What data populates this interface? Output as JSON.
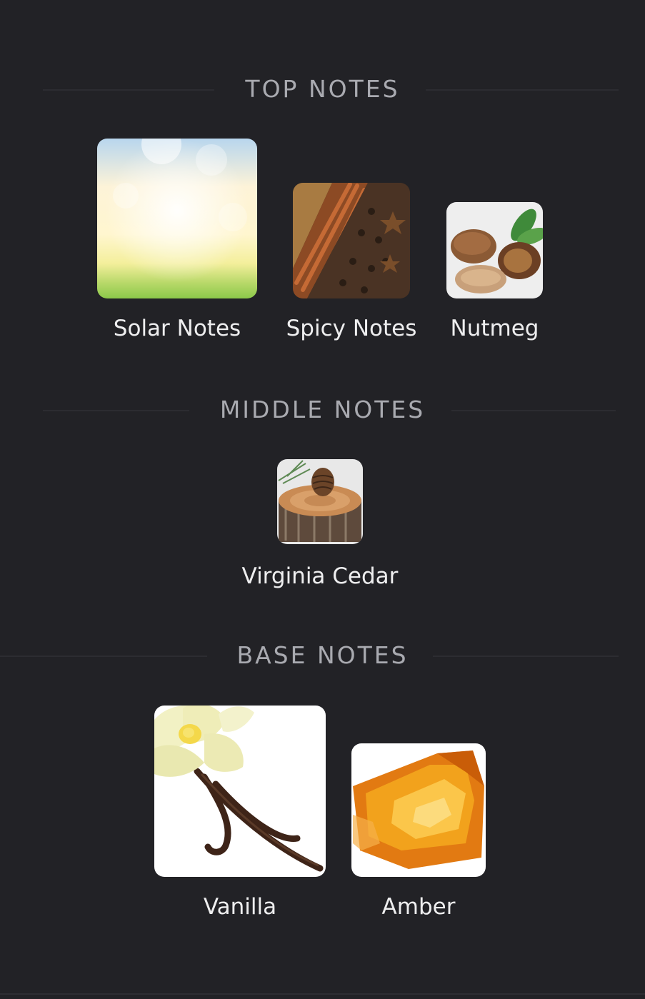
{
  "sections": {
    "top": {
      "title": "TOP NOTES",
      "notes": [
        {
          "label": "Solar Notes",
          "image": "solar-notes-image"
        },
        {
          "label": "Spicy Notes",
          "image": "spicy-notes-image"
        },
        {
          "label": "Nutmeg",
          "image": "nutmeg-image"
        }
      ]
    },
    "middle": {
      "title": "MIDDLE NOTES",
      "notes": [
        {
          "label": "Virginia Cedar",
          "image": "virginia-cedar-image"
        }
      ]
    },
    "base": {
      "title": "BASE NOTES",
      "notes": [
        {
          "label": "Vanilla",
          "image": "vanilla-image"
        },
        {
          "label": "Amber",
          "image": "amber-image"
        }
      ]
    }
  },
  "colors": {
    "background": "#222226",
    "header_text": "#a9aab0",
    "label_text": "#eeeeef",
    "rule": "#2c2c31"
  }
}
